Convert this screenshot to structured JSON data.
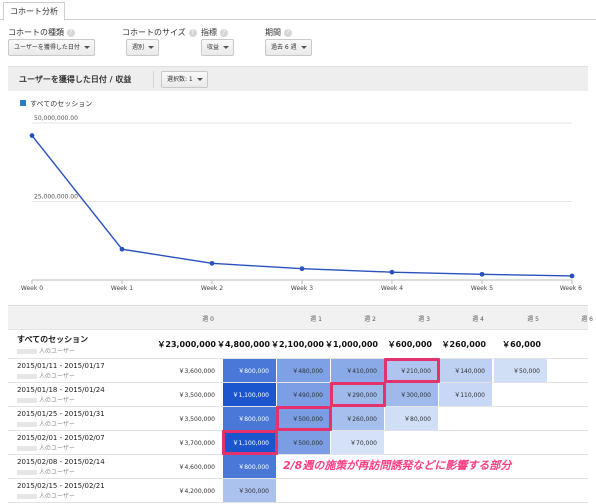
{
  "tab": {
    "label": "コホート分析"
  },
  "controls": [
    {
      "label": "コホートの種類",
      "value": "ユーザーを獲得した日付"
    },
    {
      "label": "コホートのサイズ",
      "value": "週別"
    },
    {
      "label": "指標",
      "value": "収益"
    },
    {
      "label": "期間",
      "value": "過去 6 週"
    }
  ],
  "help_glyph": "?",
  "panel": {
    "title": "ユーザーを獲得した日付 / 収益",
    "select_label": "選択数: 1"
  },
  "legend": {
    "label": "すべてのセッション",
    "color": "#2a7ec1"
  },
  "chart_data": {
    "type": "line",
    "x": [
      "Week 0",
      "Week 1",
      "Week 2",
      "Week 3",
      "Week 4",
      "Week 5",
      "Week 6"
    ],
    "series": [
      {
        "name": "すべてのセッション",
        "values": [
          46000000,
          9800000,
          5300000,
          3600000,
          2500000,
          1800000,
          1300000
        ],
        "color": "#2a52be"
      }
    ],
    "yticks": [
      {
        "value": 50000000,
        "label": "50,000,000.00"
      },
      {
        "value": 25000000,
        "label": "25,000,000.00"
      }
    ],
    "ylim": [
      0,
      50000000
    ]
  },
  "table": {
    "headers": [
      "週 0",
      "週 1",
      "週 2",
      "週 3",
      "週 4",
      "週 5",
      "週 6"
    ],
    "summary": {
      "title": "すべてのセッション",
      "subtitle": "人のユーザー",
      "values": [
        "￥23,000,000",
        "￥4,800,000",
        "￥2,100,000",
        "￥1,000,000",
        "￥600,000",
        "￥260,000",
        "￥60,000"
      ]
    },
    "rows": [
      {
        "range": "2015/01/11 - 2015/01/17",
        "users_label": "人のユーザー",
        "values": [
          "￥3,600,000",
          "￥800,000",
          "￥480,000",
          "￥410,000",
          "￥210,000",
          "￥140,000",
          "￥50,000"
        ]
      },
      {
        "range": "2015/01/18 - 2015/01/24",
        "users_label": "人のユーザー",
        "values": [
          "￥3,500,000",
          "￥1,100,000",
          "￥490,000",
          "￥290,000",
          "￥300,000",
          "￥110,000",
          ""
        ]
      },
      {
        "range": "2015/01/25 - 2015/01/31",
        "users_label": "人のユーザー",
        "values": [
          "￥3,500,000",
          "￥800,000",
          "￥500,000",
          "￥260,000",
          "￥80,000",
          "",
          ""
        ]
      },
      {
        "range": "2015/02/01 - 2015/02/07",
        "users_label": "人のユーザー",
        "values": [
          "￥3,700,000",
          "￥1,100,000",
          "￥500,000",
          "￥70,000",
          "",
          "",
          ""
        ]
      },
      {
        "range": "2015/02/08 - 2015/02/14",
        "users_label": "人のユーザー",
        "values": [
          "￥4,600,000",
          "￥800,000",
          "",
          "",
          "",
          "",
          ""
        ]
      },
      {
        "range": "2015/02/15 - 2015/02/21",
        "users_label": "人のユーザー",
        "values": [
          "￥4,200,000",
          "￥300,000",
          "",
          "",
          "",
          "",
          ""
        ]
      }
    ],
    "heat_levels": [
      [
        0,
        0.78,
        0.52,
        0.46,
        0.28,
        0.2,
        0.12
      ],
      [
        0,
        1.0,
        0.53,
        0.36,
        0.36,
        0.16,
        -1
      ],
      [
        0,
        0.78,
        0.54,
        0.32,
        0.12,
        -1,
        -1
      ],
      [
        0,
        1.0,
        0.54,
        0.1,
        -1,
        -1,
        -1
      ],
      [
        0,
        0.78,
        -1,
        -1,
        -1,
        -1,
        -1
      ],
      [
        0,
        0.3,
        -1,
        -1,
        -1,
        -1,
        -1
      ]
    ],
    "highlighted": [
      [
        0,
        4
      ],
      [
        1,
        3
      ],
      [
        2,
        2
      ],
      [
        3,
        1
      ]
    ]
  },
  "annotation": "2/8週の施策が再訪問誘発などに影響する部分"
}
